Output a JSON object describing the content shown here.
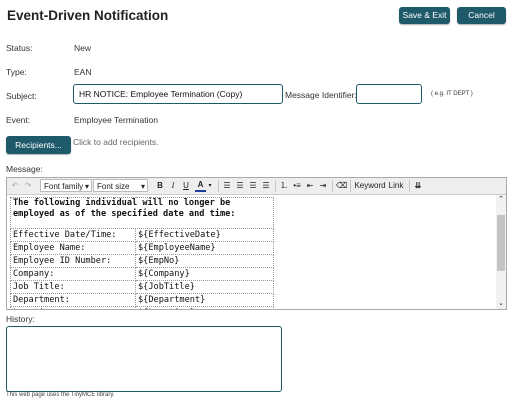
{
  "page": {
    "title": "Event-Driven Notification",
    "save_exit_label": "Save & Exit",
    "cancel_label": "Cancel"
  },
  "form": {
    "status_label": "Status:",
    "status_value": "New",
    "type_label": "Type:",
    "type_value": "EAN",
    "subject_label": "Subject:",
    "subject_value": "HR NOTICE: Employee Termination (Copy)",
    "message_identifier_label": "Message Identifier:",
    "message_identifier_value": "",
    "message_identifier_hint": "( e.g. IT DEPT )",
    "event_label": "Event:",
    "event_value": "Employee Termination",
    "recipients_button": "Recipients...",
    "recipients_hint": "Click to add recipients.",
    "message_label": "Message:",
    "history_label": "History:",
    "history_value": ""
  },
  "toolbar": {
    "font_family": "Font family",
    "font_size": "Font size",
    "bold": "B",
    "italic": "I",
    "underline": "U",
    "text_color": "A",
    "keyword": "Keyword",
    "link": "Link"
  },
  "message": {
    "heading": "The following individual will no longer be employed as of the specified date and time:",
    "rows": [
      [
        "Effective Date/Time:",
        "${EffectiveDate}"
      ],
      [
        "Employee Name:",
        "${EmployeeName}"
      ],
      [
        "Employee ID Number:",
        "${EmpNo}"
      ],
      [
        "Company:",
        "${Company}"
      ],
      [
        "Job Title:",
        "${JobTitle}"
      ],
      [
        "Department:",
        "${Department}"
      ],
      [
        "Location:",
        "${Location}"
      ]
    ]
  },
  "footer": {
    "text": "This web page uses the TinyMCE library."
  },
  "colors": {
    "accent": "#1e5a6a",
    "toolbar_bg": "#eeeeee",
    "text_color_underline": "#1a3fa0"
  }
}
